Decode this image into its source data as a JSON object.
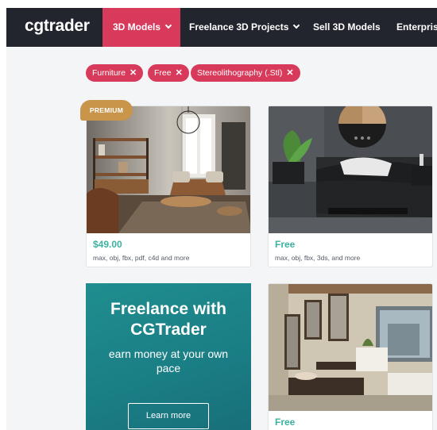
{
  "nav": {
    "logo": "cgtrader",
    "items": [
      {
        "label": "3D Models",
        "active": true
      },
      {
        "label": "Freelance 3D Projects",
        "active": false
      },
      {
        "label": "Sell 3D Models",
        "active": false
      },
      {
        "label": "Enterprise",
        "active": false
      }
    ]
  },
  "filters": [
    {
      "label": "Furniture",
      "remove": "✕"
    },
    {
      "label": "Free",
      "remove": "✕"
    },
    {
      "label": "Stereolithography (.Stl)",
      "remove": "✕"
    }
  ],
  "products": [
    {
      "badge": "PREMIUM",
      "price": "$49.00",
      "formats": "max, obj, fbx, pdf, c4d and more"
    },
    {
      "price": "Free",
      "formats": "max, obj, fbx, 3ds, and more"
    },
    {
      "price": "Free",
      "formats": ""
    }
  ],
  "promo": {
    "title_line1": "Freelance with",
    "title_line2": "CGTrader",
    "sub_line1": "earn money at your own",
    "sub_line2": "pace",
    "button": "Learn more"
  },
  "colors": {
    "nav_bg": "#22252d",
    "accent": "#d73a5b",
    "price": "#3bb3a0",
    "premium": "#c9954a",
    "promo_bg": "#1b7f86"
  }
}
